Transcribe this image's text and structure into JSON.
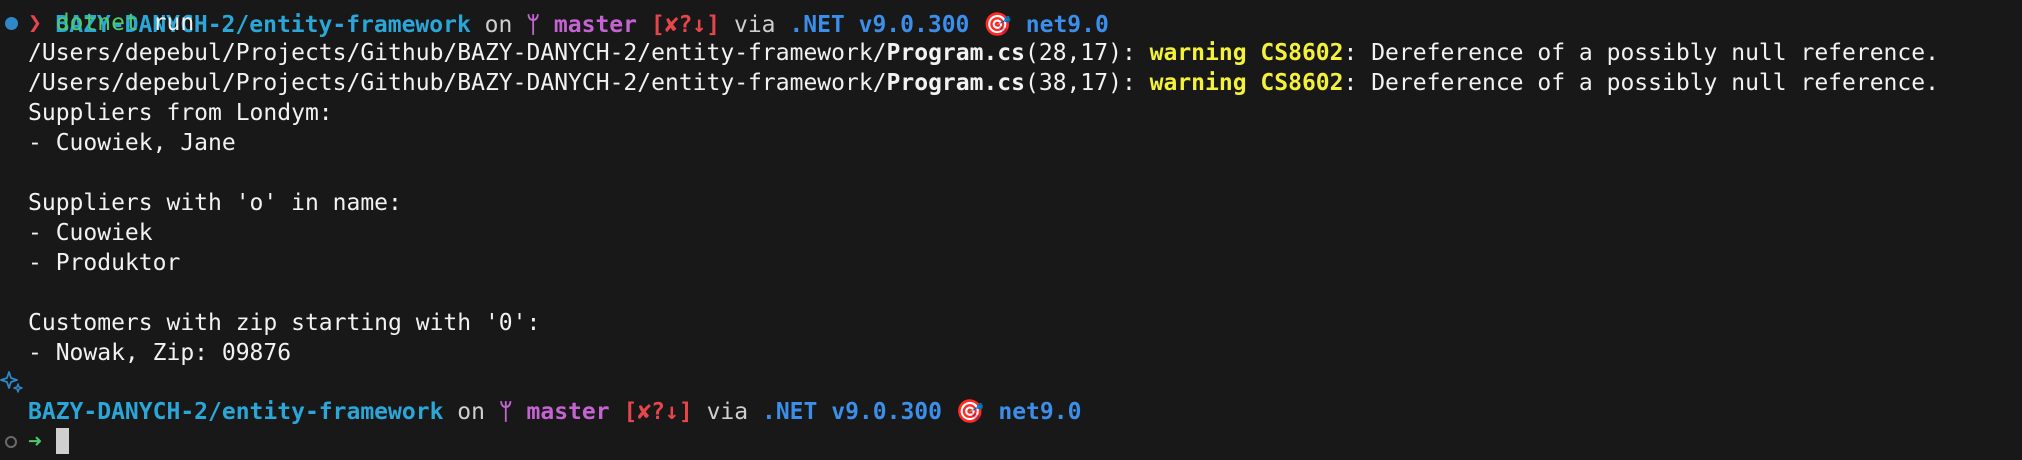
{
  "top_cut": {
    "dir": "BAZY-DANYCH-2/entity-framework",
    "on": "on",
    "branch_icon": "ᛘ",
    "branch": "master",
    "status": "[✘?↓]",
    "via": "via",
    "dotnet": ".NET v9.0.300",
    "target_icon": "🎯",
    "target": "net9.0"
  },
  "command": {
    "prompt_symbol": "❯",
    "cmd": "dotnet",
    "arg": "run"
  },
  "warnings": [
    {
      "path": "/Users/depebul/Projects/Github/BAZY-DANYCH-2/entity-framework/",
      "file": "Program.cs",
      "pos": "(28,17): ",
      "label": "warning CS8602",
      "message": ": Dereference of a possibly null reference."
    },
    {
      "path": "/Users/depebul/Projects/Github/BAZY-DANYCH-2/entity-framework/",
      "file": "Program.cs",
      "pos": "(38,17): ",
      "label": "warning CS8602",
      "message": ": Dereference of a possibly null reference."
    }
  ],
  "output": [
    "Suppliers from Londym:",
    "- Cuowiek, Jane",
    "",
    "Suppliers with 'o' in name:",
    "- Cuowiek",
    "- Produktor",
    "",
    "Customers with zip starting with '0':",
    "- Nowak, Zip: 09876"
  ],
  "prompt": {
    "dir": "BAZY-DANYCH-2/entity-framework",
    "on": "on",
    "branch_icon": "ᛘ",
    "branch": "master",
    "status": "[✘?↓]",
    "via": "via",
    "dotnet": ".NET v9.0.300",
    "target_icon": "🎯",
    "target": "net9.0"
  },
  "input_prompt": {
    "symbol": "➜"
  },
  "colors": {
    "background": "#181818",
    "error_red": "#e5454b",
    "warning_yellow": "#f4f13a",
    "dir_cyan": "#2aa7d8",
    "branch_magenta": "#c464d2",
    "dotnet_blue": "#3b8eea",
    "prompt_green": "#4ec96a"
  }
}
